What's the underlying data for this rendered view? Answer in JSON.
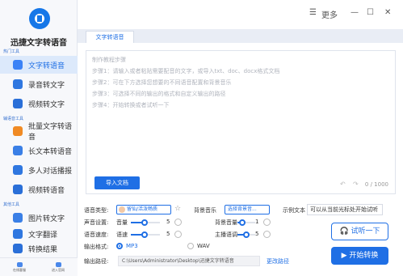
{
  "app": {
    "name": "迅捷文字转语音"
  },
  "sidebar": {
    "section1": "热门工具",
    "section2": "辅语音工具",
    "section3": "其他工具",
    "items": [
      {
        "label": "文字转语音",
        "color": "#3b82f6"
      },
      {
        "label": "录音转文字",
        "color": "#2f77e0"
      },
      {
        "label": "视频转文字",
        "color": "#2a6fd8"
      },
      {
        "label": "批量文字转语音",
        "color": "#f08a24"
      },
      {
        "label": "长文本转语音",
        "color": "#3a7fe6"
      },
      {
        "label": "多人对话播报",
        "color": "#2f77e0"
      },
      {
        "label": "视频转语音",
        "color": "#2a6fd8"
      },
      {
        "label": "图片转文字",
        "color": "#3a7fe6"
      },
      {
        "label": "文字翻译",
        "color": "#2f77e0"
      },
      {
        "label": "转换结果",
        "color": "#2a6fd8"
      }
    ],
    "bottom": [
      {
        "label": "在线客服"
      },
      {
        "label": "进入官网"
      }
    ]
  },
  "titlebar": {
    "more": "更多",
    "minimize": "—",
    "maximize": "☐",
    "close": "✕",
    "menu": "☰"
  },
  "tab": {
    "label": "文字转语音"
  },
  "editor": {
    "placeholder_lines": [
      "制作教程步骤",
      "步骤1：请输入或者粘贴需要配音的文字，或导入txt、doc、docx格式文档",
      "步骤2：可在下方选择您想要的不同语音配置和背景音乐",
      "步骤3：可选择不同的输出的格式和自定义输出的路径",
      "步骤4：开始转换或者试听一下"
    ],
    "import_label": "导入文档",
    "count": "0 / 1000"
  },
  "settings": {
    "voice_type_label": "语音类型:",
    "voice_name": "留仙/活泼畅质",
    "bg_music_label": "背景音乐",
    "bg_music_btn": "选择背景音...",
    "sample_label": "示例文本",
    "sample_text": "可以从当前光标处开始试听",
    "sound_label": "声音设置:",
    "volume_label": "音量",
    "volume_value": "5",
    "bg_volume_label": "背景音量",
    "bg_volume_value": "1",
    "speed_label": "语音速度:",
    "speed_sub": "语速",
    "speed_value": "5",
    "pitch_label": "主播语调",
    "pitch_value": "5",
    "format_label": "输出格式:",
    "format_mp3": "MP3",
    "format_wav": "WAV",
    "path_label": "输出路径:",
    "path_value": "C:\\Users\\Administrator\\Desktop\\迅捷文字转语音",
    "change_path": "更改路径",
    "try_label": "试听一下",
    "start_label": "开始转换"
  }
}
